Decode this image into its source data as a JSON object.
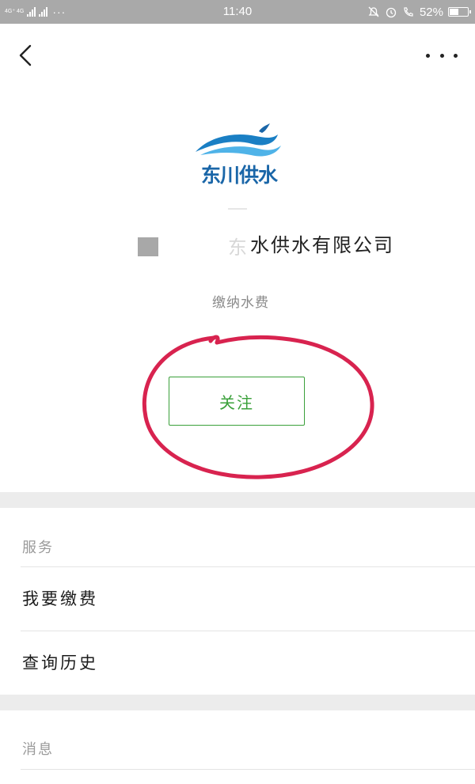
{
  "status_bar": {
    "network_label": "4G⁺ 4G",
    "time": "11:40",
    "battery": "52%",
    "battery_level": 0.52
  },
  "nav": {
    "back_icon": "chevron-left-icon",
    "more_icon": "more-horizontal-icon"
  },
  "account": {
    "logo_text": "东川供水",
    "name": "水供水有限公司",
    "description": "缴纳水费"
  },
  "actions": {
    "follow_label": "关注"
  },
  "services": {
    "title": "服务",
    "items": [
      {
        "label": "我要缴费"
      },
      {
        "label": "查询历史"
      }
    ]
  },
  "messages": {
    "title": "消息"
  },
  "colors": {
    "status_bar_bg": "#a9a9a9",
    "accent_green": "#3aa03a",
    "annotation_red": "#d8234f",
    "logo_blue": "#1a66a8",
    "section_gap": "#ececec"
  }
}
